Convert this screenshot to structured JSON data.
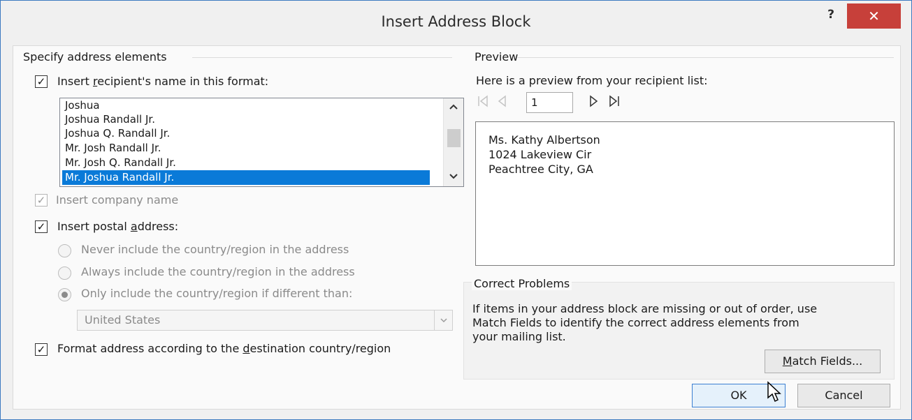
{
  "window": {
    "title": "Insert Address Block",
    "help_label": "?",
    "close_label": "✕"
  },
  "specify": {
    "group_label": "Specify address elements",
    "insert_name": {
      "checked": true,
      "label_pre": "Insert ",
      "label_key": "r",
      "label_post": "ecipient's name in this format:"
    },
    "name_formats": [
      "Joshua",
      "Joshua Randall Jr.",
      "Joshua Q. Randall Jr.",
      "Mr. Josh Randall Jr.",
      "Mr. Josh Q. Randall Jr.",
      "Mr. Joshua Randall Jr."
    ],
    "selected_format_index": 5,
    "insert_company": {
      "checked": true,
      "disabled": true,
      "label": "Insert company name"
    },
    "insert_postal": {
      "checked": true,
      "label_pre": "Insert postal ",
      "label_key": "a",
      "label_post": "ddress:"
    },
    "country_options": [
      {
        "label": "Never include the country/region in the address",
        "selected": false
      },
      {
        "label": "Always include the country/region in the address",
        "selected": false
      },
      {
        "label": "Only include the country/region if different than:",
        "selected": true
      }
    ],
    "country_value": "United States",
    "format_by_country": {
      "checked": true,
      "label_pre": "Format address according to the ",
      "label_key": "d",
      "label_post": "estination country/region"
    }
  },
  "preview": {
    "group_label": "Preview",
    "intro": "Here is a preview from your recipient list:",
    "record_number": "1",
    "address_lines": [
      "Ms. Kathy Albertson",
      "1024 Lakeview Cir",
      "Peachtree City, GA"
    ]
  },
  "correct": {
    "group_label": "Correct Problems",
    "text_lines": [
      "If items in your address block are missing or out of order, use",
      "Match Fields to identify the correct address elements from",
      "your mailing list."
    ],
    "match_fields_key": "M",
    "match_fields_rest": "atch Fields..."
  },
  "buttons": {
    "ok": "OK",
    "cancel": "Cancel"
  },
  "icons": {
    "check": "✓",
    "first": "first-record-icon",
    "prev": "prev-record-icon",
    "next": "next-record-icon",
    "last": "last-record-icon"
  }
}
